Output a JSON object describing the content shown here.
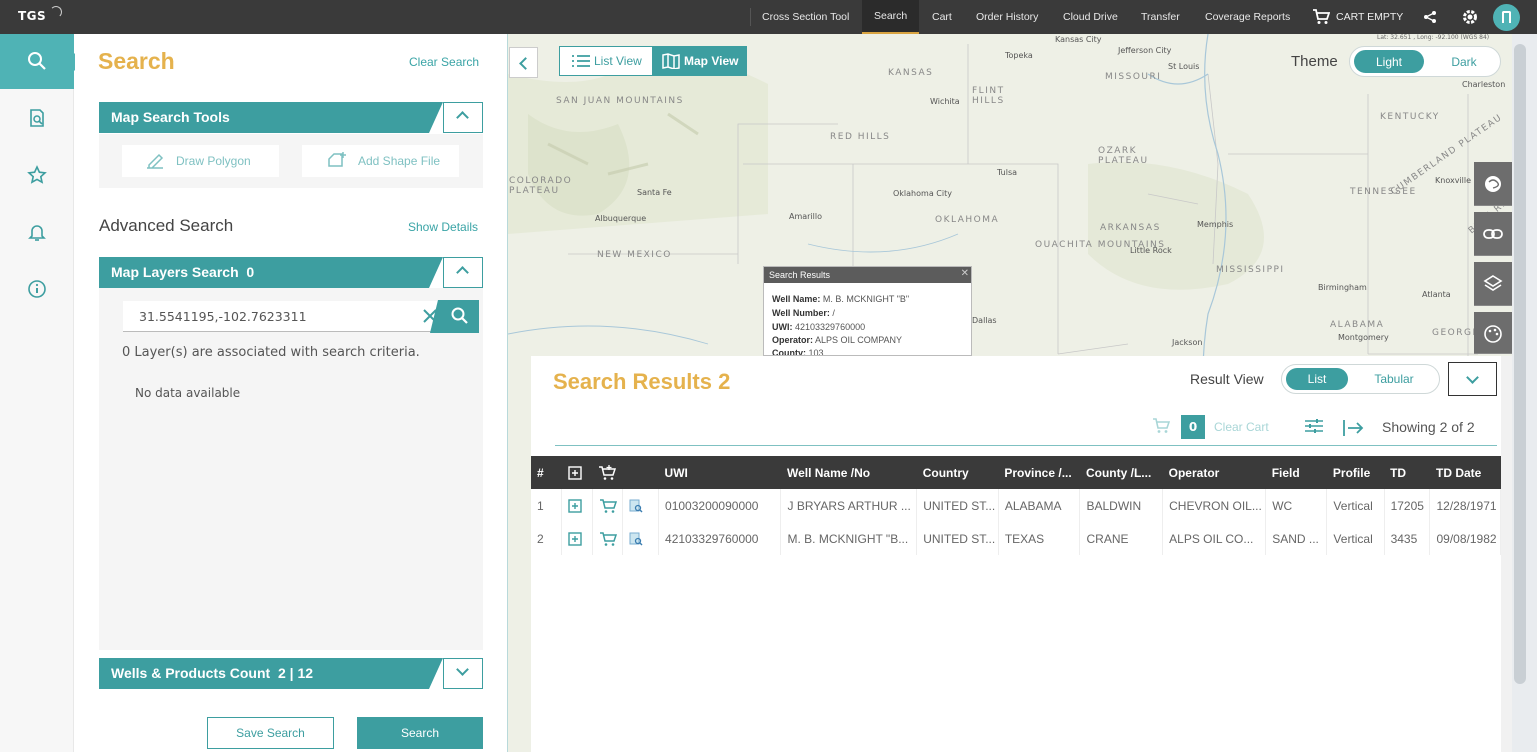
{
  "topnav": {
    "logo": "TGS",
    "items": [
      {
        "label": "Cross Section Tool",
        "active": false
      },
      {
        "label": "Search",
        "active": true
      },
      {
        "label": "Cart",
        "active": false
      },
      {
        "label": "Order History",
        "active": false
      },
      {
        "label": "Cloud Drive",
        "active": false
      },
      {
        "label": "Transfer",
        "active": false
      },
      {
        "label": "Coverage Reports",
        "active": false
      }
    ],
    "cart_label": "CART EMPTY"
  },
  "rail": {
    "icons": [
      "search-icon",
      "document-search-icon",
      "star-icon",
      "bell-icon",
      "info-icon"
    ]
  },
  "panel": {
    "title": "Search",
    "clear_search": "Clear Search",
    "map_search_tools": "Map Search Tools",
    "draw_polygon": "Draw Polygon",
    "add_shape_file": "Add Shape File",
    "advanced_search": "Advanced Search",
    "show_details": "Show Details",
    "map_layers_search": "Map Layers Search",
    "map_layers_count": "0",
    "coord_value": "31.5541195,-102.7623311",
    "layers_info": "0 Layer(s) are associated with search criteria.",
    "no_data": "No data available",
    "wells_products": "Wells & Products Count",
    "wells_products_count": "2 | 12",
    "save_search": "Save Search",
    "search_button": "Search"
  },
  "map": {
    "list_view": "List View",
    "map_view": "Map View",
    "theme_label": "Theme",
    "theme_light": "Light",
    "theme_dark": "Dark",
    "coords_readout": "Lat: 32.651 , Long: -92.100 (WGS 84)",
    "labels": {
      "kansas_city": "Kansas City",
      "jefferson_city": "Jefferson City",
      "topeka": "Topeka",
      "st_louis": "St Louis",
      "kansas": "KANSAS",
      "missouri": "MISSOURI",
      "flint_hills": "FLINT HILLS",
      "wichita": "Wichita",
      "red_hills": "RED HILLS",
      "ozark_plateau": "OZARK PLATEAU",
      "tulsa": "Tulsa",
      "oklahoma_city": "Oklahoma City",
      "oklahoma": "OKLAHOMA",
      "arkansas": "ARKANSAS",
      "ouachita": "OUACHITA MOUNTAINS",
      "memphis": "Memphis",
      "little_rock": "Little Rock",
      "albuquerque": "Albuquerque",
      "santa_fe": "Santa Fe",
      "amarillo": "Amarillo",
      "new_mexico": "NEW MEXICO",
      "colorado_plateau": "COLORADO PLATEAU",
      "san_juan": "SAN JUAN MOUNTAINS",
      "kentucky": "KENTUCKY",
      "tennessee": "TENNESSEE",
      "knoxville": "Knoxville",
      "mississippi": "MISSISSIPPI",
      "birmingham": "Birmingham",
      "alabama": "ALABAMA",
      "montgomery": "Montgomery",
      "georgia": "GEORGIA",
      "atlanta": "Atlanta",
      "jackson": "Jackson",
      "dallas": "Dallas",
      "charleston": "Charleston",
      "cumberland": "CUMBERLAND PLATEAU",
      "ridge": "BLUE RIDGE"
    }
  },
  "popup": {
    "title": "Search Results",
    "well_name_label": "Well Name:",
    "well_name": "M. B. MCKNIGHT \"B\"",
    "well_number_label": "Well Number:",
    "well_number": "/",
    "uwi_label": "UWI:",
    "uwi": "42103329760000",
    "operator_label": "Operator:",
    "operator": "ALPS OIL COMPANY",
    "county_label": "County:",
    "county": "103"
  },
  "results": {
    "title": "Search Results 2",
    "result_view": "Result View",
    "view_list": "List",
    "view_tabular": "Tabular",
    "cart_count": "0",
    "clear_cart": "Clear Cart",
    "showing": "Showing 2 of 2",
    "columns": [
      "#",
      "",
      "",
      "",
      "UWI",
      "Well Name /No",
      "Country",
      "Province /...",
      "County /L...",
      "Operator",
      "Field",
      "Profile",
      "TD",
      "TD Date"
    ],
    "rows": [
      {
        "num": "1",
        "uwi": "01003200090000",
        "well": "J BRYARS ARTHUR ...",
        "country": "UNITED ST...",
        "province": "ALABAMA",
        "county": "BALDWIN",
        "operator": "CHEVRON OIL...",
        "field": "WC",
        "profile": "Vertical",
        "td": "17205",
        "td_date": "12/28/1971"
      },
      {
        "num": "2",
        "uwi": "42103329760000",
        "well": "M. B. MCKNIGHT \"B...",
        "country": "UNITED ST...",
        "province": "TEXAS",
        "county": "CRANE",
        "operator": "ALPS OIL CO...",
        "field": "SAND ...",
        "profile": "Vertical",
        "td": "3435",
        "td_date": "09/08/1982"
      }
    ]
  }
}
